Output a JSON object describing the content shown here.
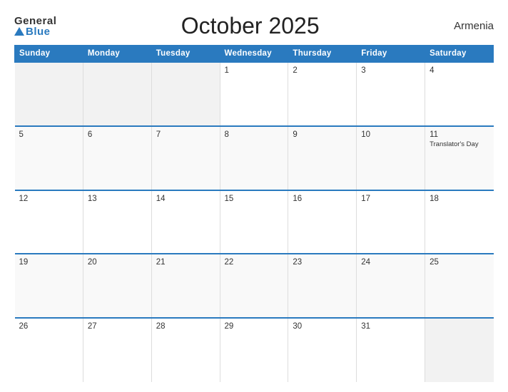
{
  "header": {
    "logo_general": "General",
    "logo_blue": "Blue",
    "title": "October 2025",
    "country": "Armenia"
  },
  "columns": [
    "Sunday",
    "Monday",
    "Tuesday",
    "Wednesday",
    "Thursday",
    "Friday",
    "Saturday"
  ],
  "weeks": [
    [
      {
        "day": "",
        "event": "",
        "empty": true
      },
      {
        "day": "",
        "event": "",
        "empty": true
      },
      {
        "day": "",
        "event": "",
        "empty": true
      },
      {
        "day": "1",
        "event": ""
      },
      {
        "day": "2",
        "event": ""
      },
      {
        "day": "3",
        "event": ""
      },
      {
        "day": "4",
        "event": ""
      }
    ],
    [
      {
        "day": "5",
        "event": ""
      },
      {
        "day": "6",
        "event": ""
      },
      {
        "day": "7",
        "event": ""
      },
      {
        "day": "8",
        "event": ""
      },
      {
        "day": "9",
        "event": ""
      },
      {
        "day": "10",
        "event": ""
      },
      {
        "day": "11",
        "event": "Translator's Day"
      }
    ],
    [
      {
        "day": "12",
        "event": ""
      },
      {
        "day": "13",
        "event": ""
      },
      {
        "day": "14",
        "event": ""
      },
      {
        "day": "15",
        "event": ""
      },
      {
        "day": "16",
        "event": ""
      },
      {
        "day": "17",
        "event": ""
      },
      {
        "day": "18",
        "event": ""
      }
    ],
    [
      {
        "day": "19",
        "event": ""
      },
      {
        "day": "20",
        "event": ""
      },
      {
        "day": "21",
        "event": ""
      },
      {
        "day": "22",
        "event": ""
      },
      {
        "day": "23",
        "event": ""
      },
      {
        "day": "24",
        "event": ""
      },
      {
        "day": "25",
        "event": ""
      }
    ],
    [
      {
        "day": "26",
        "event": ""
      },
      {
        "day": "27",
        "event": ""
      },
      {
        "day": "28",
        "event": ""
      },
      {
        "day": "29",
        "event": ""
      },
      {
        "day": "30",
        "event": ""
      },
      {
        "day": "31",
        "event": ""
      },
      {
        "day": "",
        "event": "",
        "empty": true
      }
    ]
  ]
}
